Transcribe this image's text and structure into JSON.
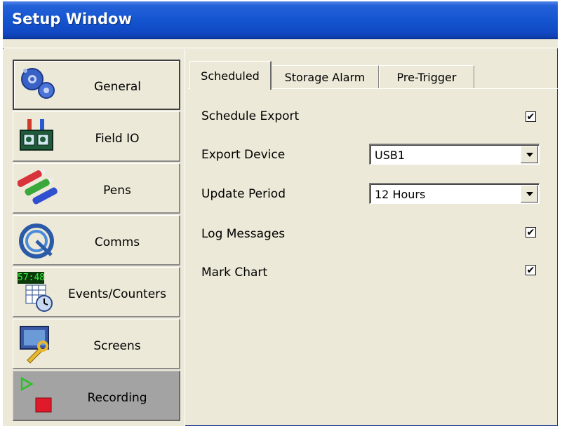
{
  "window": {
    "title": "Setup Window"
  },
  "sidebar": {
    "items": [
      {
        "label": "General",
        "icon": "gears-icon",
        "state": "active"
      },
      {
        "label": "Field IO",
        "icon": "field-io-icon",
        "state": "normal"
      },
      {
        "label": "Pens",
        "icon": "pens-icon",
        "state": "normal"
      },
      {
        "label": "Comms",
        "icon": "cable-icon",
        "state": "normal"
      },
      {
        "label": "Events/Counters",
        "icon": "clock-calendar-icon",
        "icon_text": "57:48",
        "state": "normal"
      },
      {
        "label": "Screens",
        "icon": "monitor-wrench-icon",
        "state": "normal"
      },
      {
        "label": "Recording",
        "icon": "play-stop-icon",
        "state": "selected"
      }
    ]
  },
  "tabs": [
    {
      "label": "Scheduled",
      "active": true
    },
    {
      "label": "Storage Alarm",
      "active": false
    },
    {
      "label": "Pre-Trigger",
      "active": false
    }
  ],
  "form": {
    "schedule_export": {
      "label": "Schedule Export",
      "checked": true
    },
    "export_device": {
      "label": "Export Device",
      "value": "USB1"
    },
    "update_period": {
      "label": "Update Period",
      "value": "12 Hours"
    },
    "log_messages": {
      "label": "Log Messages",
      "checked": true
    },
    "mark_chart": {
      "label": "Mark Chart",
      "checked": true
    }
  },
  "colors": {
    "titlebar": "#1455d0",
    "panel": "#ece9d8",
    "selected_item": "#a3a3a3"
  }
}
